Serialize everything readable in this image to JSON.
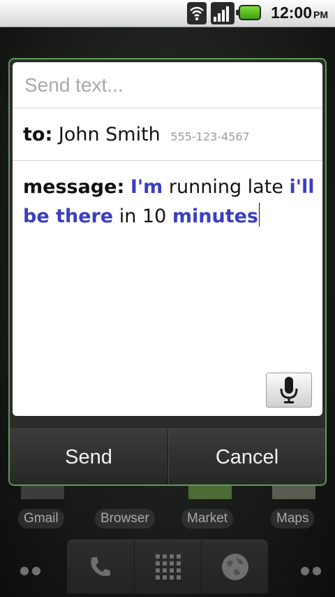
{
  "status_bar": {
    "time": "12:00",
    "ampm": "PM",
    "icons": [
      "wifi-icon",
      "signal-icon",
      "battery-icon"
    ],
    "battery_color": "#5cc227"
  },
  "dialog": {
    "title_placeholder": "Send text...",
    "to_label": "to:",
    "recipient_name": "John Smith",
    "recipient_number": "555-123-4567",
    "message_label": "message:",
    "message_parts": [
      {
        "text": "I'm",
        "keyword": true
      },
      {
        "text": "running late",
        "keyword": false
      },
      {
        "text": "i'll be there",
        "keyword": true
      },
      {
        "text": "in 10",
        "keyword": false
      },
      {
        "text": "minutes",
        "keyword": true
      }
    ],
    "keyword_color": "#3a3ec4",
    "mic_icon": "microphone-icon",
    "send_label": "Send",
    "cancel_label": "Cancel"
  },
  "home": {
    "app_labels": [
      "Gmail",
      "Browser",
      "Market",
      "Maps"
    ],
    "dock_icons": [
      "phone-icon",
      "app-grid-icon",
      "globe-icon"
    ]
  }
}
